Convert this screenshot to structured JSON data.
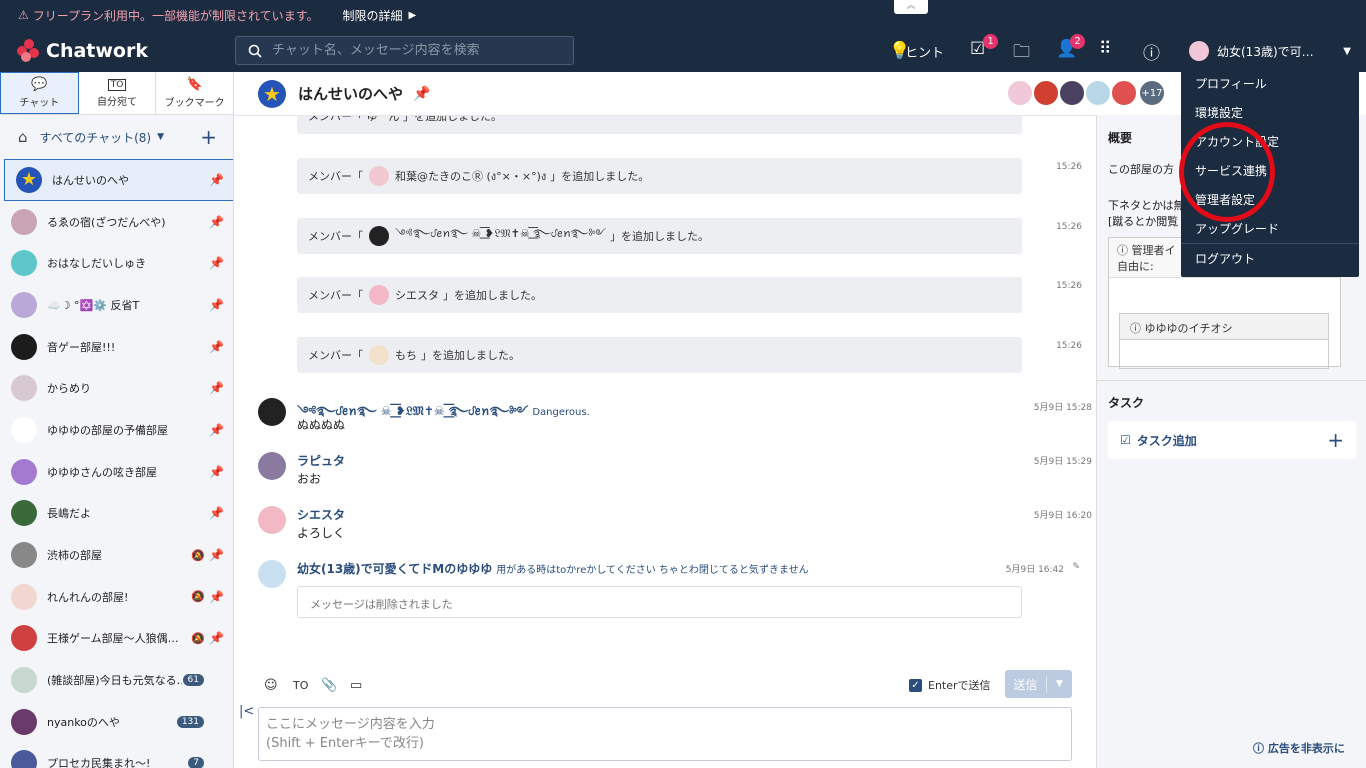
{
  "notice": {
    "text": "フリープラン利用中。一部機能が制限されています。",
    "detail": "制限の詳細"
  },
  "header": {
    "logo": "Chatwork",
    "search_placeholder": "チャット名、メッセージ内容を検索",
    "hint": "ヒント",
    "task_badge": "1",
    "contact_badge": "2",
    "user_name": "幼女(13歳)で可…"
  },
  "tabs": [
    {
      "label": "チャット",
      "icon": "chat-icon"
    },
    {
      "label": "自分宛て",
      "icon": "to-icon",
      "glyph": "TO"
    },
    {
      "label": "ブックマーク",
      "icon": "bookmark-icon"
    }
  ],
  "sidebar": {
    "filter": "すべてのチャット(8)",
    "rooms": [
      {
        "name": "はんせいのへや",
        "pinned": true,
        "active": true,
        "color": "#2554b8"
      },
      {
        "name": "るゑの宿(ざつだんべや)",
        "pinned": true,
        "color": "#c9a4b4"
      },
      {
        "name": "おはなしだいしゅき",
        "pinned": true,
        "color": "#5ec7c9"
      },
      {
        "name": "☁️☽ °✡️⚙️ 反省T",
        "pinned": true,
        "color": "#b9a8d8"
      },
      {
        "name": "音ゲー部屋!!!",
        "pinned": true,
        "color": "#1c1c1c"
      },
      {
        "name": "からめり",
        "pinned": true,
        "color": "#d8c8d0"
      },
      {
        "name": "ゆゆゆの部屋の予備部屋",
        "pinned": true,
        "color": "#ffffff"
      },
      {
        "name": "ゆゆゆさんの呟き部屋",
        "pinned": true,
        "color": "#a47ad0"
      },
      {
        "name": "長嶋だよ",
        "pinned": true,
        "color": "#3a6a3a"
      },
      {
        "name": "渋柿の部屋",
        "pinned": true,
        "muted": true,
        "color": "#888888"
      },
      {
        "name": "れんれんの部屋!",
        "pinned": true,
        "muted": true,
        "color": "#f0d8d0"
      },
      {
        "name": "王様ゲーム部屋〜人狼偶…",
        "pinned": true,
        "muted": true,
        "color": "#d04040"
      },
      {
        "name": "(雑談部屋)今日も元気なる…",
        "count": "61",
        "color": "#c8d8d0"
      },
      {
        "name": "nyankoのへや",
        "count": "131",
        "color": "#6a3a6a"
      },
      {
        "name": "プロセカ民集まれ〜!",
        "count": "7",
        "color": "#4a5a9a"
      }
    ]
  },
  "room": {
    "title": "はんせいのへや",
    "members_more": "+17"
  },
  "timeline": {
    "system": [
      {
        "prefix": "メンバー「",
        "name": "和葉@たきのこⓇ (ง°×・×°)ง",
        "suffix": "」を追加しました。",
        "time": "15:26",
        "color": "#f4c8d0"
      },
      {
        "prefix": "メンバー「",
        "name": "༺࿐ᦔꫀꪀ࿐ ☠︎ ͟͟͞͞❥𝔏𝔐✝︎☠︎ ͟͟͞͞࿐ᦔꫀꪀ࿐༻",
        "suffix": "」を追加しました。",
        "time": "15:26",
        "color": "#222222"
      },
      {
        "prefix": "メンバー「",
        "name": "シエスタ",
        "suffix": "」を追加しました。",
        "time": "15:26",
        "color": "#f2b8c6"
      },
      {
        "prefix": "メンバー「",
        "name": "もち",
        "suffix": "」を追加しました。",
        "time": "15:26",
        "color": "#f2e2cc"
      }
    ],
    "partial_top": "メンバー「 ゆ゛ん 」を追加しました。",
    "messages": [
      {
        "sender": "༺࿐ᦔꫀꪀ࿐ ☠︎ ͟͟͞͞❥𝔏𝔐✝︎☠︎ ͟͟͞͞࿐ᦔꫀꪀ࿐༻",
        "sub": "Dangerous.",
        "body": "ぬぬぬぬ",
        "time": "5月9日 15:28",
        "color": "#222222"
      },
      {
        "sender": "ラピュタ",
        "sub": "",
        "body": "おお",
        "time": "5月9日 15:29",
        "color": "#8a7aa0"
      },
      {
        "sender": "シエスタ",
        "sub": "",
        "body": "よろしく",
        "time": "5月9日 16:20",
        "color": "#f2b8c6"
      },
      {
        "sender": "幼女(13歳)で可愛くてドMのゆゆゆ",
        "sub": "用がある時はtoかreかしてください ちゃとわ閉じてると気ずきません",
        "body": "メッセージは削除されました",
        "time": "5月9日 16:42",
        "color": "#c8e0f0"
      }
    ]
  },
  "composer": {
    "enter_label": "Enterで送信",
    "send": "送信",
    "placeholder": "ここにメッセージ内容を入力\n(Shift + Enterキーで改行)",
    "to": "TO"
  },
  "right": {
    "overview": "概要",
    "overview_line1": "この部屋の方",
    "overview_line2": "下ネタとかは無",
    "overview_line3": "[蹴るとか閲覧",
    "note_title": "管理者イ",
    "note_line": "自由に:",
    "note2_title": "ゆゆゆのイチオシ",
    "task": "タスク",
    "task_add": "タスク追加",
    "ad_hide": "広告を非表示に"
  },
  "dropdown": [
    "プロフィール",
    "環境設定",
    "アカウント設定",
    "サービス連携",
    "管理者設定",
    "アップグレード",
    "ログアウト"
  ]
}
